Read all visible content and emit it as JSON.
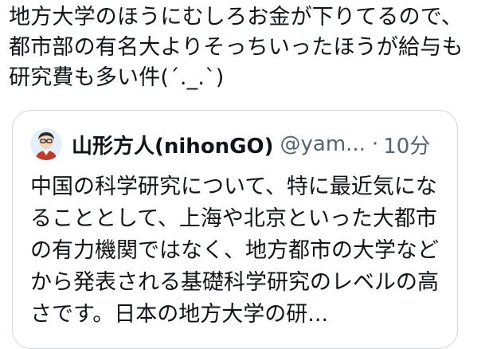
{
  "tweet": {
    "text": "地方大学のほうにむしろお金が下りてるので、都市部の有名大よりそっちいったほうが給与も研究費も多い件(´._.`)"
  },
  "quote": {
    "name": "山形方人(nihonGO)",
    "handle": "@yam...",
    "separator": "·",
    "time": "10分",
    "avatar_icon": "person-avatar",
    "text": "中国の科学研究について、特に最近気になることとして、上海や北京といった大都市の有力機関ではなく、地方都市の大学などから発表される基礎科学研究のレベルの高さです。日本の地方大学の研..."
  },
  "colors": {
    "text": "#0f1419",
    "secondary": "#536471",
    "border": "#cfd9de",
    "avatar_bg": "#e3f0fb"
  }
}
